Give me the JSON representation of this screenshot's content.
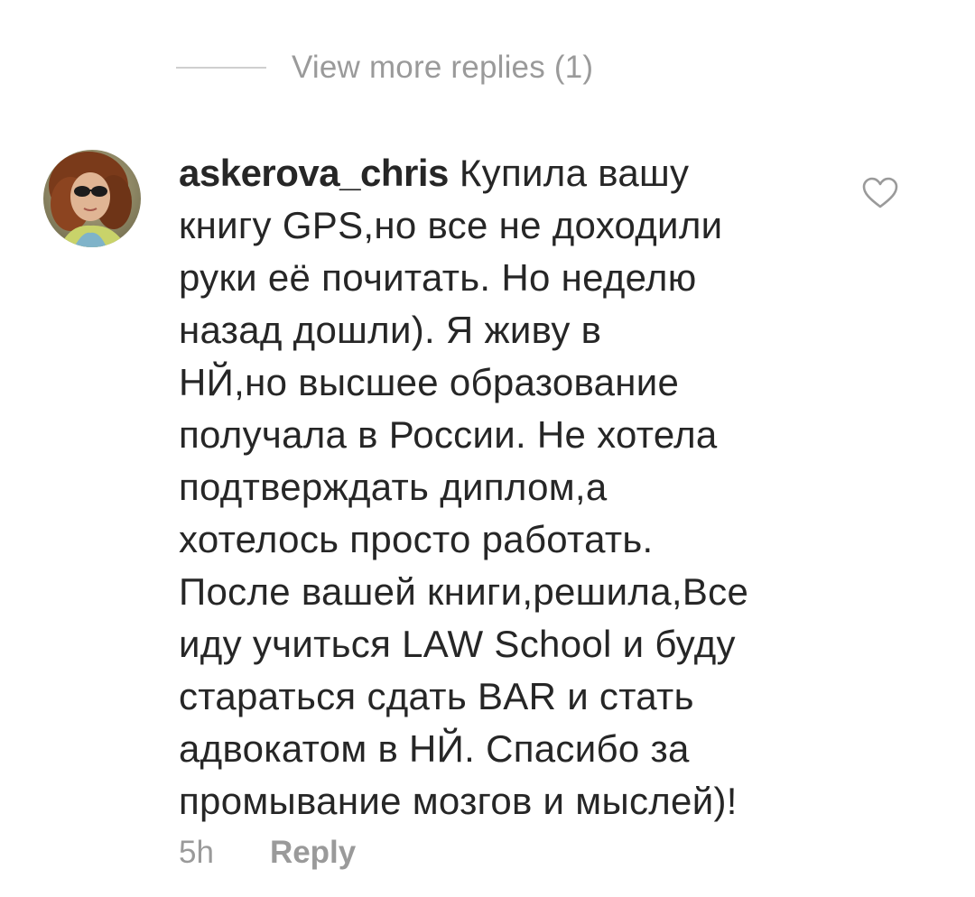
{
  "replies": {
    "view_more_label": "View more replies (1)"
  },
  "comment": {
    "username": "askerova_chris",
    "lines": [
      "Купила вашу",
      "книгу GPS,но все не доходили",
      "руки её почитать. Но неделю",
      "назад дошли). Я живу в",
      "НЙ,но высшее образование",
      "получала в России. Не хотела",
      "подтверждать диплом,а",
      "хотелось просто работать.",
      "После вашей книги,решила,Все",
      "иду учиться LAW School и буду",
      "стараться сдать BAR и стать",
      "адвокатом в НЙ. Спасибо за",
      "промывание мозгов и мыслей)!"
    ],
    "timestamp": "5h",
    "reply_label": "Reply",
    "like_icon": "heart-outline-icon"
  },
  "colors": {
    "text": "#262626",
    "secondary_text": "#9a9a9a",
    "divider": "#cfcfcf",
    "background": "#ffffff"
  }
}
